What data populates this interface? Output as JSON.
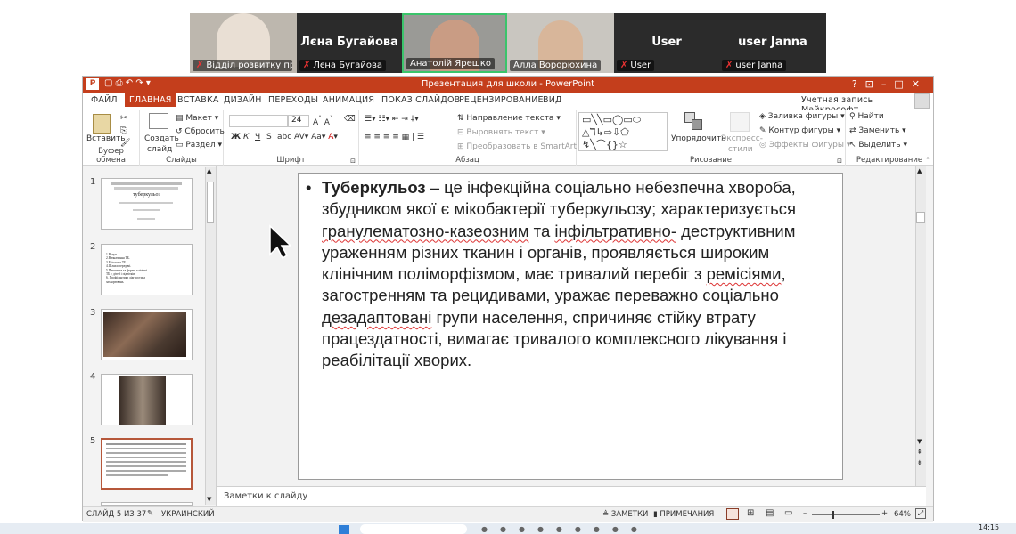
{
  "participants": [
    {
      "label": "Відділ розвитку пр...",
      "big": ""
    },
    {
      "label": "Лєна Бугайова",
      "big": "Лєна Бугайова"
    },
    {
      "label": "Анатолій Ярешко",
      "big": ""
    },
    {
      "label": "Алла Ворорюхина",
      "big": ""
    },
    {
      "label": "User",
      "big": "User"
    },
    {
      "label": "user Janna",
      "big": "user Janna"
    }
  ],
  "window": {
    "title": "Презентация для школи - PowerPoint",
    "controls": [
      "?",
      "⊡",
      "–",
      "□",
      "✕"
    ],
    "account": "Учетная запись Майкрософт"
  },
  "tabs": [
    "ФАЙЛ",
    "ГЛАВНАЯ",
    "ВСТАВКА",
    "ДИЗАЙН",
    "ПЕРЕХОДЫ",
    "АНИМАЦИЯ",
    "ПОКАЗ СЛАЙДОВ",
    "РЕЦЕНЗИРОВАНИЕ",
    "ВИД"
  ],
  "ribbon": {
    "clipboard": {
      "paste": "Вставить",
      "label": "Буфер обмена"
    },
    "slides": {
      "create": "Создать",
      "create2": "слайд",
      "layout": "Макет",
      "reset": "Сбросить",
      "section": "Раздел",
      "label": "Слайды"
    },
    "font": {
      "size": "24",
      "bold": "Ж",
      "italic": "К",
      "underline": "Ч",
      "strike": "S",
      "label": "Шрифт"
    },
    "paragraph": {
      "direction": "Направление текста",
      "align": "Выровнять текст",
      "smartart": "Преобразовать в SmartArt",
      "label": "Абзац"
    },
    "drawing": {
      "arrange": "Упорядочить",
      "styles": "Экспресс-",
      "styles2": "стили",
      "fill": "Заливка фигуры",
      "outline": "Контур фигуры",
      "effects": "Эффекты фигуры",
      "label": "Рисование"
    },
    "editing": {
      "find": "Найти",
      "replace": "Заменить",
      "select": "Выделить",
      "label": "Редактирование"
    }
  },
  "thumbnails": [
    {
      "num": "1",
      "title": "туберкульоз"
    },
    {
      "num": "2",
      "lines": [
        "1.Вступ",
        "2.Визначення ТБ.",
        "3.Етіологія ТБ.",
        "4.Шляхи передачі.",
        "5.Патогенез та форми клінічні",
        "  ТБ у дітей і підлітків",
        "6. Профілактика діагностика",
        "  захворювань"
      ]
    },
    {
      "num": "3"
    },
    {
      "num": "4"
    },
    {
      "num": "5"
    }
  ],
  "slide": {
    "bullet": "•",
    "bold_term": "Туберкульоз",
    "t1": " – це інфекційна соціально небезпечна хвороба, збудником якої є мікобактерії туберкульозу; характеризується ",
    "s1": "гранулематозно-казеозним",
    "t2": " та ",
    "s2": "інфільтративно-",
    "t3": " деструктивним ураженням різних тканин і органів, проявляється широким клінічним поліморфізмом,  має тривалий перебіг з ",
    "s3": "ремісіями",
    "t4": ", загостренням та рецидивами, уражає переважно соціально ",
    "s4": "дезадаптовані",
    "t5": " групи населення, спричиняє стійку втрату працездатності, вимагає тривалого комплексного лікування і реабілітації хворих."
  },
  "notes_placeholder": "Заметки к слайду",
  "status": {
    "slide": "СЛАЙД 5 ИЗ 37",
    "language": "УКРАИНСКИЙ",
    "notes": "ЗАМЕТКИ",
    "comments": "ПРИМЕЧАНИЯ",
    "zoom": "64%"
  },
  "clock": "14:15",
  "colors": {
    "accent": "#c43e1c",
    "ribbon_bg": "#ffffff"
  }
}
